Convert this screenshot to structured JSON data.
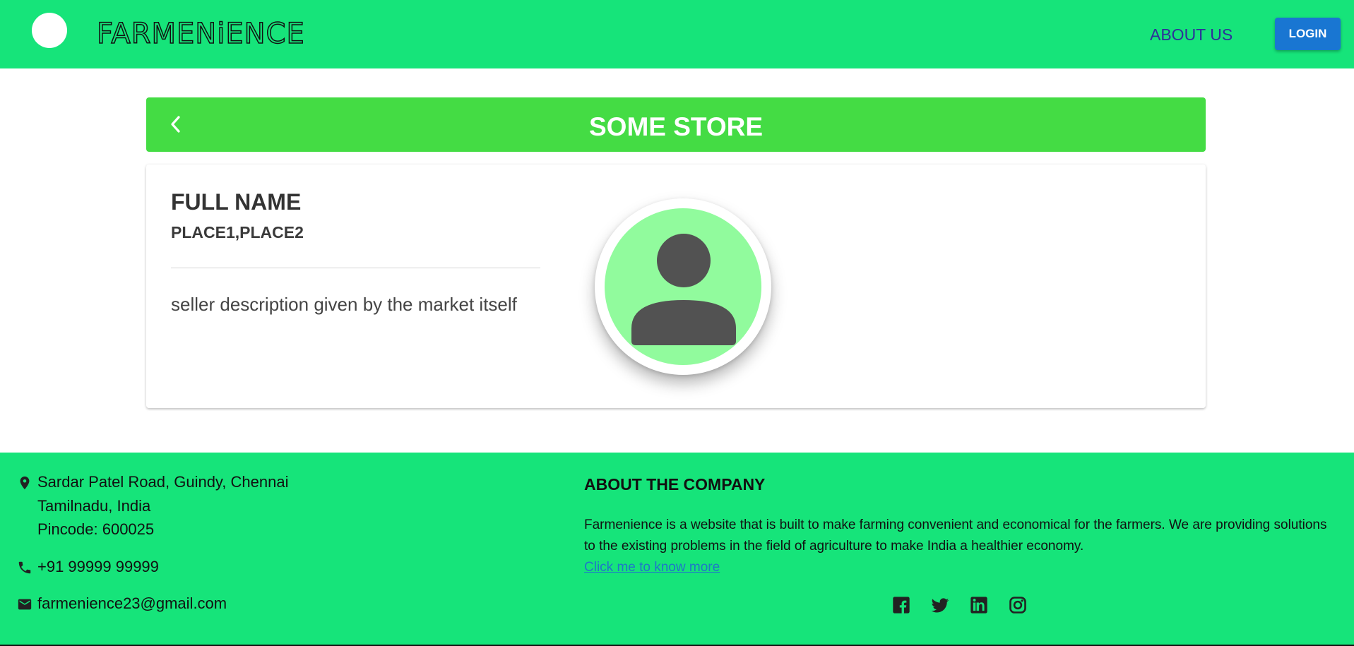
{
  "header": {
    "brand": "FARMENiENCE",
    "nav_about": "ABOUT US",
    "login_label": "LOGIN"
  },
  "store": {
    "title": "SOME STORE"
  },
  "seller": {
    "full_name": "FULL NAME",
    "places": "PLACE1,PLACE2",
    "description": "seller description given by the market itself"
  },
  "footer": {
    "address_line1": "Sardar Patel Road, Guindy, Chennai",
    "address_line2": "Tamilnadu, India",
    "address_line3": "Pincode: 600025",
    "phone": "+91 99999 99999",
    "email": "farmenience23@gmail.com",
    "about_title": "ABOUT THE COMPANY",
    "about_text": "Farmenience is a website that is built to make farming convenient and economical for the farmers. We are providing solutions to the existing problems in the field of agriculture to make India a healthier economy.",
    "about_link": "Click me to know more"
  },
  "icons": {
    "logo": "logo-circle",
    "back": "chevron-left-icon",
    "avatar": "person-icon",
    "location": "location-pin-icon",
    "phone": "phone-icon",
    "email": "mail-icon",
    "social": [
      "facebook-icon",
      "twitter-icon",
      "linkedin-icon",
      "instagram-icon"
    ]
  },
  "colors": {
    "primary_green": "#16e47a",
    "banner_green": "#44dc44",
    "avatar_bg": "#91fb9d",
    "login_blue": "#1976d2",
    "link_blue": "#1e78c8"
  }
}
